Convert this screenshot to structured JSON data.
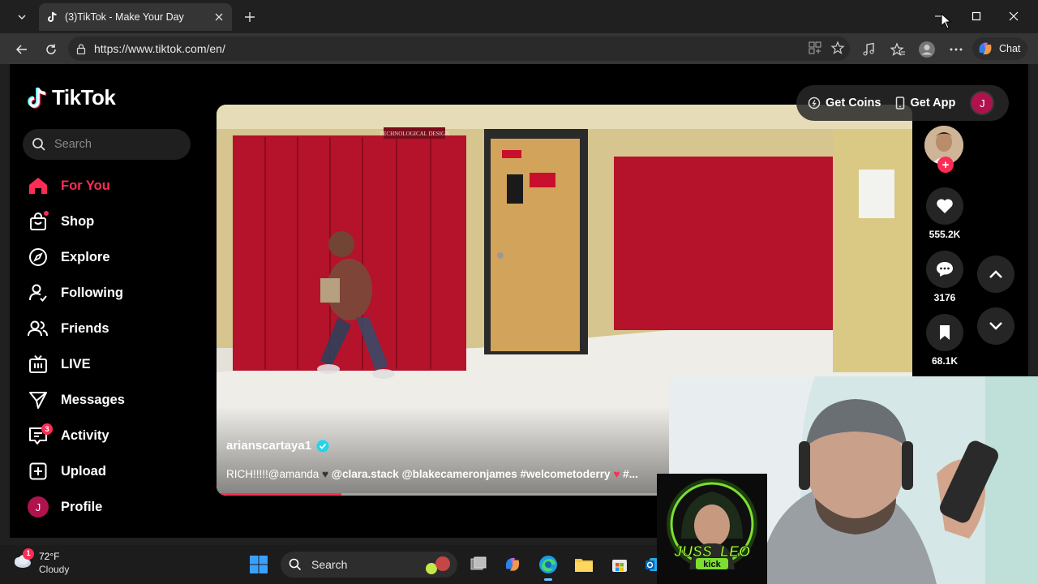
{
  "browser": {
    "tab_title": "(3)TikTok - Make Your Day",
    "url": "https://www.tiktok.com/en/",
    "chat_label": "Chat"
  },
  "tiktok": {
    "logo_text": "TikTok",
    "search_placeholder": "Search",
    "nav": [
      {
        "label": "For You",
        "icon": "home-icon",
        "active": true
      },
      {
        "label": "Shop",
        "icon": "shop-bag-icon"
      },
      {
        "label": "Explore",
        "icon": "compass-icon"
      },
      {
        "label": "Following",
        "icon": "following-icon"
      },
      {
        "label": "Friends",
        "icon": "friends-icon"
      },
      {
        "label": "LIVE",
        "icon": "live-icon"
      },
      {
        "label": "Messages",
        "icon": "messages-icon"
      },
      {
        "label": "Activity",
        "icon": "activity-icon",
        "badge": "3"
      },
      {
        "label": "Upload",
        "icon": "upload-icon"
      },
      {
        "label": "Profile",
        "icon": "profile-avatar",
        "avatar_letter": "J"
      }
    ],
    "top_actions": {
      "get_coins": "Get Coins",
      "get_app": "Get App",
      "user_initial": "J"
    },
    "video": {
      "author": "arianscartaya1",
      "caption_text": "RICH!!!!!@amanda",
      "caption_tags": "@clara.stack @blakecameronjames #welcometoderry",
      "caption_more": "#...",
      "sign_text": "TECHNOLOGICAL DESIGN",
      "progress": 0.18
    },
    "actions": {
      "likes": "555.2K",
      "comments": "3176",
      "saves": "68.1K"
    }
  },
  "overlay": {
    "streamer_logo_text": "JUSS_LEO",
    "streamer_logo_sub": "kick"
  },
  "taskbar": {
    "temperature": "72°F",
    "condition": "Cloudy",
    "weather_badge": "1",
    "search_label": "Search"
  },
  "colors": {
    "accent": "#fe2c55",
    "verified": "#20d5ec",
    "locker_red": "#b5122b"
  }
}
